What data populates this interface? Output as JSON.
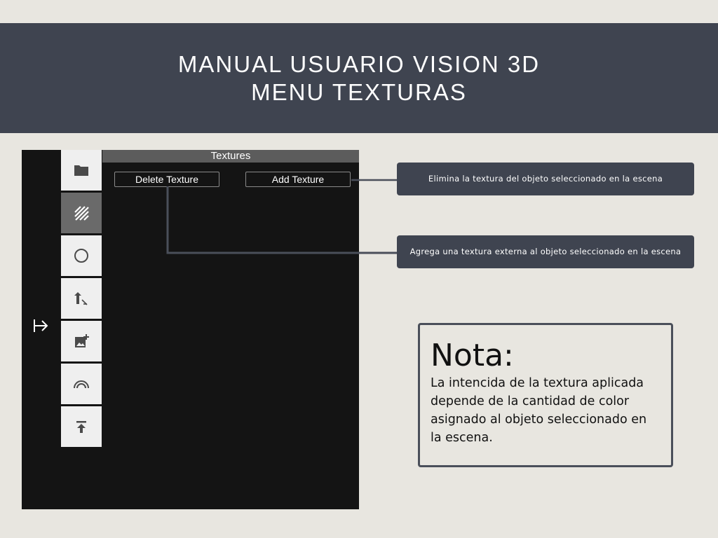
{
  "banner": {
    "title_line1": "MANUAL USUARIO VISION 3D",
    "title_line2": "MENU TEXTURAS"
  },
  "app": {
    "panel_title": "Textures",
    "delete_button": "Delete Texture",
    "add_button": "Add Texture",
    "toolbar": [
      {
        "icon": "folder-icon",
        "active": false
      },
      {
        "icon": "texture-hatch-icon",
        "active": true
      },
      {
        "icon": "circle-icon",
        "active": false
      },
      {
        "icon": "light-icon",
        "active": false
      },
      {
        "icon": "add-image-icon",
        "active": false
      },
      {
        "icon": "arch-icon",
        "active": false
      },
      {
        "icon": "upload-icon",
        "active": false
      }
    ],
    "exit_icon": "exit-arrow-icon"
  },
  "callouts": {
    "delete_desc": "Elimina la textura del objeto seleccionado en la escena",
    "add_desc": "Agrega una textura externa al objeto seleccionado en la escena"
  },
  "note": {
    "title": "Nota:",
    "body": "La intencida de la textura aplicada depende de la cantidad de color asignado al objeto seleccionado en la escena."
  },
  "colors": {
    "background": "#e8e6e0",
    "banner": "#3f4450",
    "app_bg": "#141414",
    "active_tool": "#6a6a6a"
  }
}
